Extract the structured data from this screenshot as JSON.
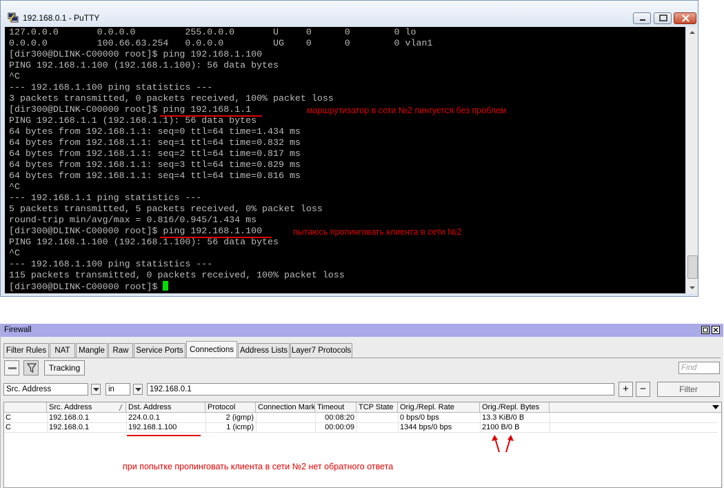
{
  "putty": {
    "title": "192.168.0.1 - PuTTY",
    "terminal_lines": [
      "127.0.0.0       0.0.0.0         255.0.0.0       U     0      0        0 lo",
      "0.0.0.0         100.66.63.254   0.0.0.0         UG    0      0        0 vlan1",
      "[dir300@DLINK-C00000 root]$ ping 192.168.1.100",
      "PING 192.168.1.100 (192.168.1.100): 56 data bytes",
      "^C",
      "--- 192.168.1.100 ping statistics ---",
      "3 packets transmitted, 0 packets received, 100% packet loss",
      "[dir300@DLINK-C00000 root]$ ping 192.168.1.1",
      "PING 192.168.1.1 (192.168.1.1): 56 data bytes",
      "64 bytes from 192.168.1.1: seq=0 ttl=64 time=1.434 ms",
      "64 bytes from 192.168.1.1: seq=1 ttl=64 time=0.832 ms",
      "64 bytes from 192.168.1.1: seq=2 ttl=64 time=0.817 ms",
      "64 bytes from 192.168.1.1: seq=3 ttl=64 time=0.829 ms",
      "64 bytes from 192.168.1.1: seq=4 ttl=64 time=0.816 ms",
      "^C",
      "--- 192.168.1.1 ping statistics ---",
      "5 packets transmitted, 5 packets received, 0% packet loss",
      "round-trip min/avg/max = 0.816/0.945/1.434 ms",
      "[dir300@DLINK-C00000 root]$ ping 192.168.1.100",
      "PING 192.168.1.100 (192.168.1.100): 56 data bytes",
      "^C",
      "--- 192.168.1.100 ping statistics ---",
      "115 packets transmitted, 0 packets received, 100% packet loss",
      "[dir300@DLINK-C00000 root]$ "
    ],
    "annotation_router": "маршрутизатор в сети №2 пингуется без проблем",
    "annotation_client": "пытаюсь пропинговать клиента в сети №2",
    "colors": {
      "terminal_bg": "#000000",
      "terminal_text": "#bbbbbb",
      "cursor": "#00e000",
      "annotation": "#e00000"
    }
  },
  "firewall": {
    "title": "Firewall",
    "tabs": [
      "Filter Rules",
      "NAT",
      "Mangle",
      "Raw",
      "Service Ports",
      "Connections",
      "Address Lists",
      "Layer7 Protocols"
    ],
    "active_tab": "Connections",
    "toolbar": {
      "tracking_label": "Tracking",
      "find_placeholder": "Find"
    },
    "filter": {
      "field": "Src. Address",
      "operator": "in",
      "value": "192.168.0.1",
      "filter_button": "Filter",
      "add_label": "+",
      "remove_label": "−"
    },
    "columns": [
      "",
      "Src. Address",
      "Dst. Address",
      "Protocol",
      "Connection Mark",
      "Timeout",
      "TCP State",
      "Orig./Repl. Rate",
      "Orig./Repl. Bytes"
    ],
    "rows": [
      {
        "flag": "C",
        "src": "192.168.0.1",
        "dst": "224.0.0.1",
        "protocol": "2 (igmp)",
        "mark": "",
        "timeout": "00:08:20",
        "tcp_state": "",
        "rate": "0 bps/0 bps",
        "bytes": "13.3 KiB/0 B"
      },
      {
        "flag": "C",
        "src": "192.168.0.1",
        "dst": "192.168.1.100",
        "protocol": "1 (icmp)",
        "mark": "",
        "timeout": "00:00:09",
        "tcp_state": "",
        "rate": "1344 bps/0 bps",
        "bytes": "2100 B/0 B"
      }
    ],
    "annotation": "при попытке пропинговать клиента в сети №2 нет обратного ответа",
    "colors": {
      "titlebar": "#aaaae8",
      "annotation": "#e00000"
    }
  }
}
